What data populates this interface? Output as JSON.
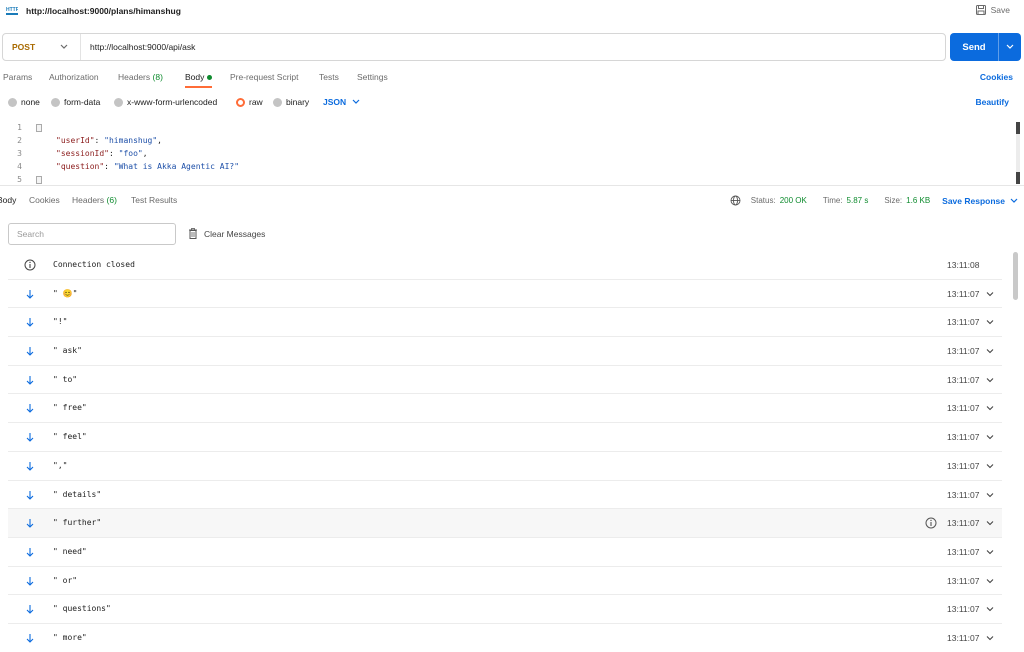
{
  "topbar": {
    "title": "http://localhost:9000/plans/himanshug",
    "save_label": "Save",
    "icon": "http-request-icon"
  },
  "request": {
    "method": "POST",
    "url": "http://localhost:9000/api/ask",
    "send_label": "Send"
  },
  "request_tabs": {
    "params": "Params",
    "authorization": "Authorization",
    "headers": "Headers",
    "headers_count": "(8)",
    "body": "Body",
    "prerequest": "Pre-request Script",
    "tests": "Tests",
    "settings": "Settings",
    "cookies": "Cookies",
    "active": "Body"
  },
  "body_types": {
    "none": "none",
    "form_data": "form-data",
    "urlencoded": "x-www-form-urlencoded",
    "raw": "raw",
    "binary": "binary",
    "selected": "raw",
    "format": "JSON",
    "beautify": "Beautify"
  },
  "editor": {
    "line_numbers": [
      "1",
      "2",
      "3",
      "4",
      "5"
    ],
    "fields": [
      {
        "key": "\"userId\"",
        "value": "\"himanshug\"",
        "tail": ","
      },
      {
        "key": "\"sessionId\"",
        "value": "\"foo\"",
        "tail": ","
      },
      {
        "key": "\"question\"",
        "value": "\"What is Akka Agentic AI?\"",
        "tail": ""
      }
    ]
  },
  "response_tabs": {
    "body": "Body",
    "cookies": "Cookies",
    "headers": "Headers",
    "headers_count": "(6)",
    "test_results": "Test Results",
    "active": "Body"
  },
  "status": {
    "status_label": "Status:",
    "status_value": "200 OK",
    "time_label": "Time:",
    "time_value": "5.87 s",
    "size_label": "Size:",
    "size_value": "1.6 KB",
    "save_response": "Save Response"
  },
  "messages_toolbar": {
    "search_placeholder": "Search",
    "clear_label": "Clear Messages"
  },
  "messages": [
    {
      "icon": "info-icon",
      "text": "Connection closed",
      "time": "13:11:08",
      "expandable": false
    },
    {
      "icon": "arrow-down-icon",
      "text": "\" 😊\"",
      "time": "13:11:07",
      "expandable": true
    },
    {
      "icon": "arrow-down-icon",
      "text": "\"!\"",
      "time": "13:11:07",
      "expandable": true
    },
    {
      "icon": "arrow-down-icon",
      "text": "\" ask\"",
      "time": "13:11:07",
      "expandable": true
    },
    {
      "icon": "arrow-down-icon",
      "text": "\" to\"",
      "time": "13:11:07",
      "expandable": true
    },
    {
      "icon": "arrow-down-icon",
      "text": "\" free\"",
      "time": "13:11:07",
      "expandable": true
    },
    {
      "icon": "arrow-down-icon",
      "text": "\" feel\"",
      "time": "13:11:07",
      "expandable": true
    },
    {
      "icon": "arrow-down-icon",
      "text": "\",\"",
      "time": "13:11:07",
      "expandable": true
    },
    {
      "icon": "arrow-down-icon",
      "text": "\" details\"",
      "time": "13:11:07",
      "expandable": true
    },
    {
      "icon": "arrow-down-icon",
      "text": "\" further\"",
      "time": "13:11:07",
      "expandable": true,
      "hover": true
    },
    {
      "icon": "arrow-down-icon",
      "text": "\" need\"",
      "time": "13:11:07",
      "expandable": true
    },
    {
      "icon": "arrow-down-icon",
      "text": "\" or\"",
      "time": "13:11:07",
      "expandable": true
    },
    {
      "icon": "arrow-down-icon",
      "text": "\" questions\"",
      "time": "13:11:07",
      "expandable": true
    },
    {
      "icon": "arrow-down-icon",
      "text": "\" more\"",
      "time": "13:11:07",
      "expandable": true
    }
  ],
  "colors": {
    "accent": "#0b6bde",
    "active_tab": "#ff6c37",
    "success": "#0e8b2e",
    "method": "#a86a00"
  }
}
